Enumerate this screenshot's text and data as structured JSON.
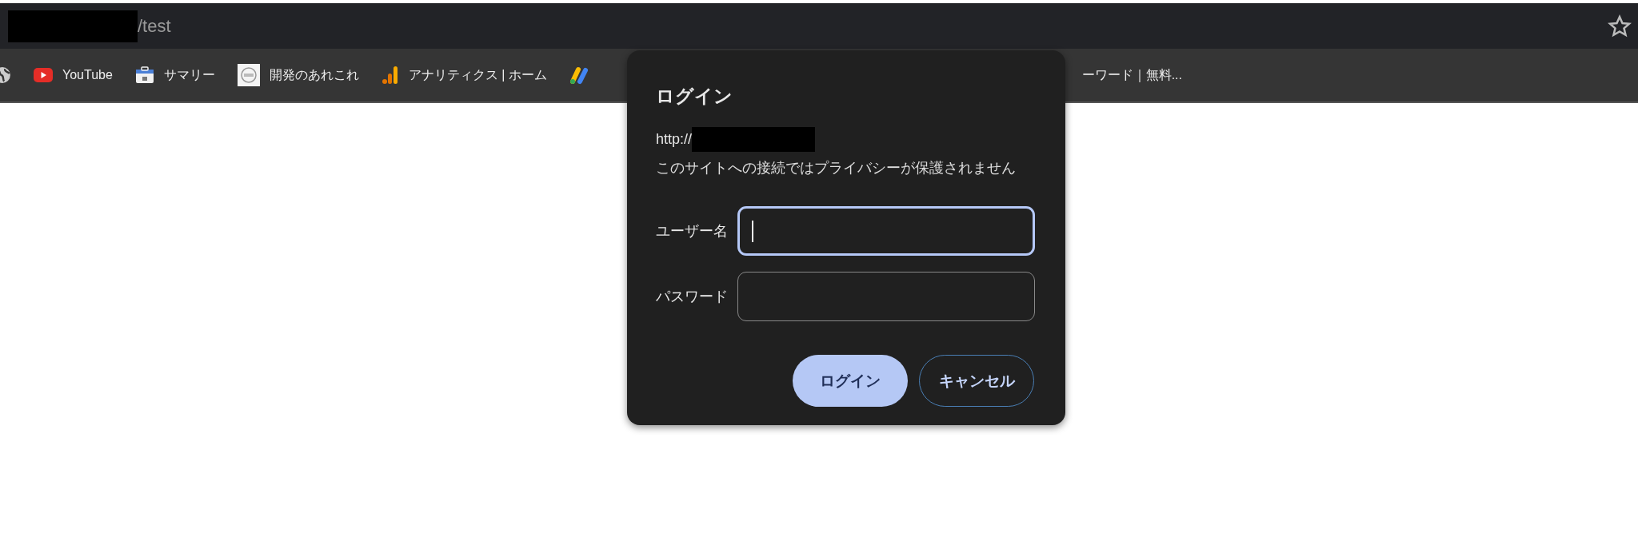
{
  "address_bar": {
    "url": "/test",
    "redacted": true
  },
  "bookmarks": [
    {
      "kind": "globe"
    },
    {
      "kind": "youtube",
      "label": "YouTube"
    },
    {
      "kind": "console",
      "label": "サマリー"
    },
    {
      "kind": "thumb",
      "label": "開発のあれこれ"
    },
    {
      "kind": "analytics",
      "label": "アナリティクス | ホーム"
    },
    {
      "kind": "ads"
    },
    {
      "kind": "behind",
      "label": "ーワード｜無料..."
    }
  ],
  "dialog": {
    "title": "ログイン",
    "origin": "http://",
    "origin_redacted": true,
    "warning": "このサイトへの接続ではプライバシーが保護されません",
    "fields": [
      {
        "label": "ユーザー名",
        "focused": true
      },
      {
        "label": "パスワード",
        "focused": false
      }
    ],
    "buttons": [
      {
        "label": "ログイン",
        "kind": "primary"
      },
      {
        "label": "キャンセル",
        "kind": "secondary"
      }
    ]
  }
}
